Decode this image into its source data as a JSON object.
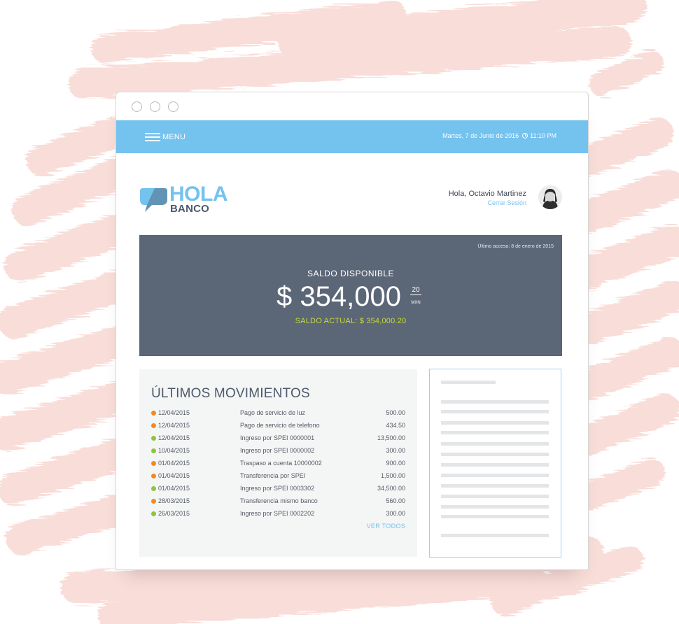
{
  "colors": {
    "topbar": "#74c2ee",
    "accent": "#74c2ee",
    "balance_card": "#5b6677",
    "current_balance": "#c7dc37",
    "dot_outgoing": "#f08c1e",
    "dot_incoming": "#8fc43e",
    "panel_bg": "#f4f5f5",
    "background_strokes": "#f7d2cc"
  },
  "window": {
    "buttons": [
      "close",
      "minimize",
      "maximize"
    ]
  },
  "topbar": {
    "menu_icon": "hamburger-icon",
    "menu_label": "MENU",
    "date": "Martes, 7 de Junio de 2016",
    "clock_icon": "clock-icon",
    "time": "11:10 PM"
  },
  "brand": {
    "logo_icon": "speech-bubble-icon",
    "line1": "HOLA",
    "line2": "BANCO"
  },
  "user": {
    "greeting": "Hola, Octavio Martinez",
    "logout_label": "Cerrar Sesión"
  },
  "balance": {
    "last_access": "Último acceso: 8 de enero de 2015",
    "label": "SALDO DISPONIBLE",
    "amount": "$ 354,000",
    "cents": "20",
    "currency": "MXN",
    "current": "SALDO ACTUAL: $ 354,000.20"
  },
  "movements": {
    "title": "ÚLTIMOS MOVIMIENTOS",
    "rows": [
      {
        "type": "outgoing",
        "date": "12/04/2015",
        "desc": "Pago de servicio de luz",
        "amount": "500.00"
      },
      {
        "type": "outgoing",
        "date": "12/04/2015",
        "desc": "Pago de servicio de telefono",
        "amount": "434.50"
      },
      {
        "type": "incoming",
        "date": "12/04/2015",
        "desc": "Ingreso por SPEI 0000001",
        "amount": "13,500.00"
      },
      {
        "type": "incoming",
        "date": "10/04/2015",
        "desc": "Ingreso por SPEI 0000002",
        "amount": "300.00"
      },
      {
        "type": "outgoing",
        "date": "01/04/2015",
        "desc": "Traspaso a cuenta 10000002",
        "amount": "900.00"
      },
      {
        "type": "outgoing",
        "date": "01/04/2015",
        "desc": "Transferencia por SPEI",
        "amount": "1,500.00"
      },
      {
        "type": "incoming",
        "date": "01/04/2015",
        "desc": "Ingreso por SPEI 0003302",
        "amount": "34,500.00"
      },
      {
        "type": "outgoing",
        "date": "28/03/2015",
        "desc": "Transferencia mismo banco",
        "amount": "560.00"
      },
      {
        "type": "incoming",
        "date": "26/03/2015",
        "desc": "Ingreso por SPEI 0002202",
        "amount": "300.00"
      }
    ],
    "see_all_label": "VER TODOS"
  }
}
